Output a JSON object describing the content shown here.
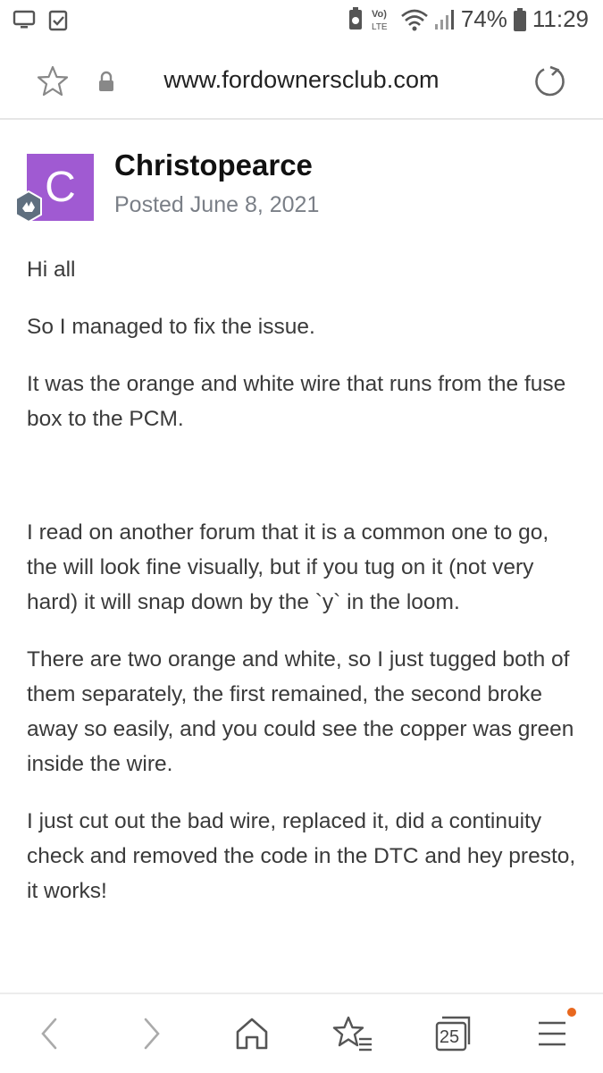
{
  "status_bar": {
    "network": "LTE",
    "battery": "74%",
    "time": "11:29"
  },
  "address_bar": {
    "url": "www.fordownersclub.com"
  },
  "post": {
    "avatar_letter": "C",
    "author": "Christopearce",
    "posted_prefix": "Posted",
    "posted_date": "June 8, 2021",
    "paragraphs": {
      "p1": "Hi all",
      "p2": "So I managed to fix the issue.",
      "p3": "It was the orange and white wire that runs from the fuse box to the PCM.",
      "p4": "I read on another forum that it is a common one to go, the will look fine visually, but if you tug on it (not very hard) it will snap down by the `y` in the loom.",
      "p5": "There are two orange and white, so I just tugged both of them separately, the first remained, the second broke away so easily, and you could see the copper was green inside the wire.",
      "p6": "I just cut out the bad wire, replaced it, did a continuity check and removed the code in the DTC and hey presto, it works!"
    }
  },
  "bottom_nav": {
    "tab_count": "25",
    "icons": [
      "back-icon",
      "forward-icon",
      "home-icon",
      "bookmarks-icon",
      "tabs-icon",
      "menu-icon"
    ]
  },
  "colors": {
    "avatar_bg": "#a05ad2",
    "notification_dot": "#e8681e",
    "meta_text": "#7a7f87"
  }
}
